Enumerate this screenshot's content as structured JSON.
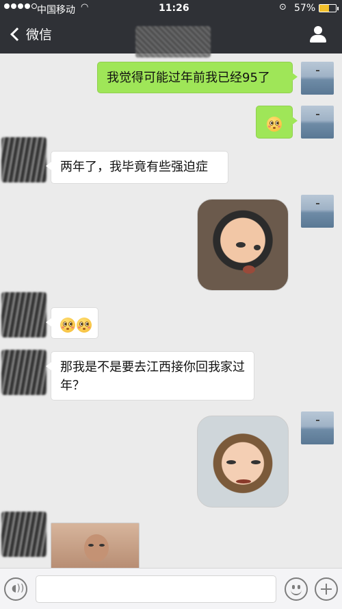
{
  "status_bar": {
    "carrier": "中国移动",
    "time": "11:26",
    "battery_percent": "57%",
    "battery_level": 0.57,
    "icons": [
      "signal-dots-icon",
      "wifi-icon",
      "rotation-lock-icon",
      "battery-icon"
    ]
  },
  "nav": {
    "back_label": "微信",
    "icons": [
      "back-chevron-icon",
      "profile-icon"
    ]
  },
  "messages": [
    {
      "from": "me",
      "type": "text",
      "text": "我觉得可能过年前我已经95了"
    },
    {
      "from": "me",
      "type": "emoji",
      "emoji": [
        "flushed-emoji"
      ]
    },
    {
      "from": "other",
      "type": "text",
      "text": "两年了，我毕竟有些强迫症"
    },
    {
      "from": "me",
      "type": "sticker",
      "sticker": "boy-side-eye-sticker"
    },
    {
      "from": "other",
      "type": "emoji",
      "emoji": [
        "flushed-emoji",
        "flushed-emoji"
      ]
    },
    {
      "from": "other",
      "type": "text",
      "text": "那我是不是要去江西接你回我家过年？"
    },
    {
      "from": "me",
      "type": "sticker",
      "sticker": "boy-smirk-sticker"
    },
    {
      "from": "other",
      "type": "sticker",
      "sticker": "man-photo-sticker"
    }
  ],
  "input_bar": {
    "value": "",
    "icons": [
      "voice-icon",
      "emoji-icon",
      "plus-icon"
    ]
  },
  "colors": {
    "nav_bg": "#2f3136",
    "chat_bg": "#ebebeb",
    "my_bubble": "#9fe658",
    "other_bubble": "#ffffff",
    "battery_fill": "#f2c02c"
  }
}
